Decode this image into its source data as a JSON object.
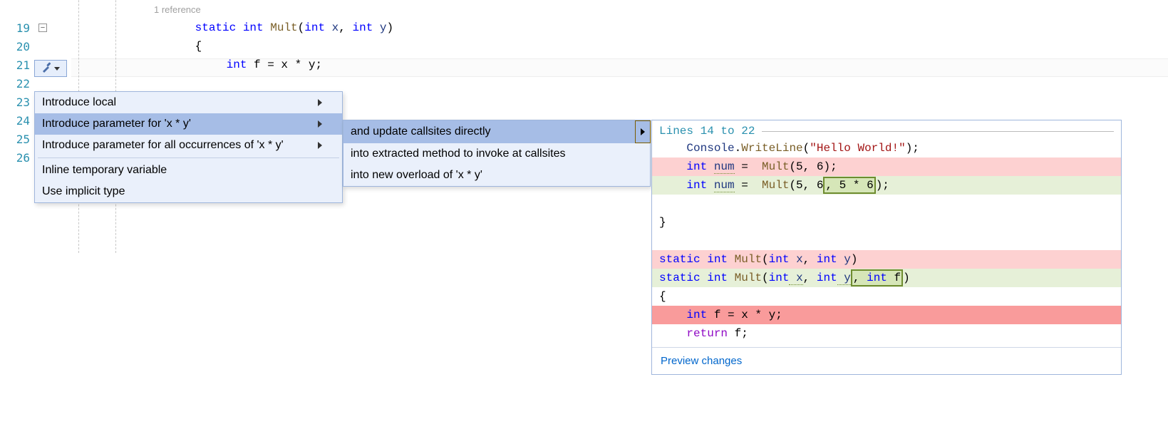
{
  "editor": {
    "ref_hint": "1 reference",
    "lines": [
      {
        "num": "19"
      },
      {
        "num": "20"
      },
      {
        "num": "21"
      },
      {
        "num": "22"
      },
      {
        "num": "23"
      },
      {
        "num": "24"
      },
      {
        "num": "25"
      },
      {
        "num": "26"
      }
    ],
    "code": {
      "l19_static": "static",
      "l19_int": "int",
      "l19_name": "Mult",
      "l19_lp": "(",
      "l19_p1t": "int",
      "l19_p1n": " x",
      "l19_comma": ", ",
      "l19_p2t": "int",
      "l19_p2n": " y",
      "l19_rp": ")",
      "l20_brace": "{",
      "l21_int": "int",
      "l21_rest": " f = x * y;"
    }
  },
  "menu": {
    "items": [
      {
        "label": "Introduce local",
        "arrow": true
      },
      {
        "label": "Introduce parameter for 'x * y'",
        "arrow": true,
        "selected": true
      },
      {
        "label": "Introduce parameter for all occurrences of 'x * y'",
        "arrow": true
      },
      {
        "label": "Inline temporary variable",
        "arrow": false,
        "sep_before": true
      },
      {
        "label": "Use implicit type",
        "arrow": false
      }
    ]
  },
  "submenu": {
    "items": [
      {
        "label": "and update callsites directly",
        "selected": true,
        "arrow": true
      },
      {
        "label": "into extracted method to invoke at callsites"
      },
      {
        "label": "into new overload of 'x * y'"
      }
    ]
  },
  "preview": {
    "header": "Lines 14 to 22",
    "footer": "Preview changes",
    "tokens": {
      "console": "Console",
      "dot": ".",
      "writeline": "WriteLine",
      "lp": "(",
      "hello": "\"Hello World!\"",
      "rp_sc": ");",
      "int": "int",
      "num": "num",
      "eq": " =  ",
      "mult": "Mult",
      "args56": "(5, 6)",
      "args56_open": "(5, 6",
      "ins_arg": ", 5 * 6",
      "close_sc": ");",
      "semicolon": ";",
      "rbrace": "}",
      "static": "static",
      "sig_xy_open": "(",
      "p_int": "int",
      "p_x": " x",
      "comma": ", ",
      "p_y": " y",
      "rp": ")",
      "ins_param": ", int f",
      "lbrace": "{",
      "f_eq": " f = x * y;",
      "return": "return",
      "ret_rest": " f;"
    }
  }
}
